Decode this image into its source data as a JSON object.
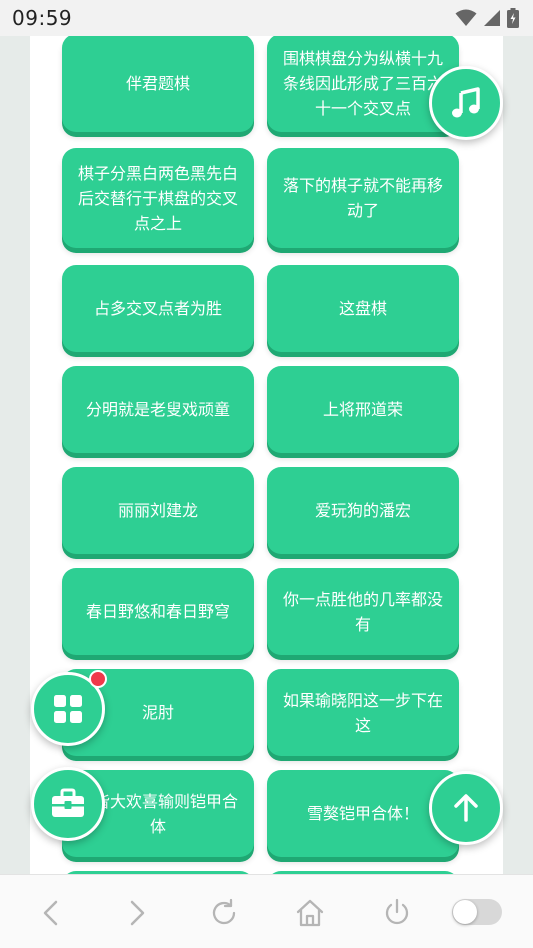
{
  "status_bar": {
    "time": "09:59",
    "icons": [
      "wifi-icon",
      "signal-icon",
      "battery-icon"
    ]
  },
  "tiles": [
    {
      "label": "伴君题棋"
    },
    {
      "label": "围棋棋盘分为纵横十九条线因此形成了三百六十一个交叉点"
    },
    {
      "label": "棋子分黑白两色黑先白后交替行于棋盘的交叉点之上"
    },
    {
      "label": "落下的棋子就不能再移动了"
    },
    {
      "label": "占多交叉点者为胜"
    },
    {
      "label": "这盘棋"
    },
    {
      "label": "分明就是老叟戏顽童"
    },
    {
      "label": "上将邢道荣"
    },
    {
      "label": "丽丽刘建龙"
    },
    {
      "label": "爱玩狗的潘宏"
    },
    {
      "label": "春日野悠和春日野穹"
    },
    {
      "label": "你一点胜他的几率都没有"
    },
    {
      "label": "泥肘"
    },
    {
      "label": "如果瑜晓阳这一步下在这"
    },
    {
      "label": "则皆大欢喜输则铠甲合体"
    },
    {
      "label": "雪獒铠甲合体！"
    }
  ],
  "fabs": {
    "music": "music-note-icon",
    "apps": "grid-icon",
    "toolbox": "toolbox-icon",
    "scroll_top": "arrow-up-icon"
  },
  "nav": [
    "back-icon",
    "forward-icon",
    "refresh-icon",
    "home-icon",
    "power-icon",
    "toggle-switch"
  ],
  "colors": {
    "accent": "#2ecf93",
    "accent_shadow": "#1fa873",
    "badge": "#f0394b"
  }
}
